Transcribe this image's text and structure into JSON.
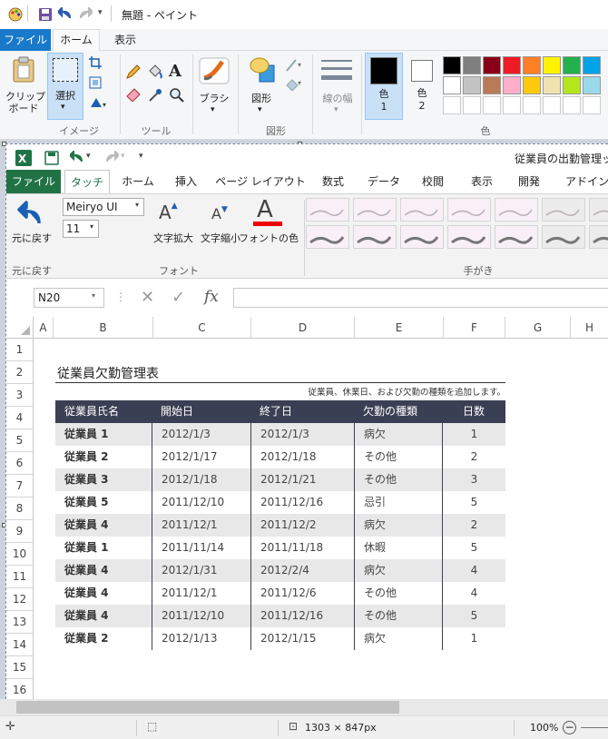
{
  "paint": {
    "window_title": "無題 - ペイント",
    "tabs": [
      "ファイル",
      "ホーム",
      "表示"
    ],
    "clipboard_label": "クリップ\nボード",
    "select_label": "選択",
    "group_image": "イメージ",
    "group_tools": "ツール",
    "brush_label": "ブラシ",
    "shapes_label": "図形",
    "group_shapes": "図形",
    "line_width_label": "線の幅",
    "color1_label": "色\n1",
    "color2_label": "色\n2",
    "group_colors": "色",
    "palette_row1": [
      "#000000",
      "#7f7f7f",
      "#880015",
      "#ed1c24",
      "#ff7f27",
      "#fff200",
      "#22b14c",
      "#00a2e8"
    ],
    "palette_row2": [
      "#ffffff",
      "#c3c3c3",
      "#b97a57",
      "#ffaec9",
      "#ffc90e",
      "#efe4b0",
      "#b5e61d",
      "#99d9ea"
    ],
    "color1": "#000000",
    "color2": "#ffffff",
    "status_dimensions": "1303 × 847px",
    "zoom": "100%"
  },
  "excel": {
    "title": "従業員の出勤管理ッ",
    "tabs": [
      "ファイル",
      "タッチ",
      "ホーム",
      "挿入",
      "ページ レイアウト",
      "数式",
      "データ",
      "校閲",
      "表示",
      "開発",
      "アドイン"
    ],
    "undo_label": "元に戻す",
    "undo_group": "元に戻す",
    "font_name": "Meiryo UI",
    "font_size": "11",
    "grow_label": "文字拡大",
    "shrink_label": "文字縮小",
    "font_color_label": "フォントの色",
    "font_group": "フォント",
    "ink_group": "手がき",
    "name_box": "N20",
    "fx": "fx",
    "columns": [
      "A",
      "B",
      "C",
      "D",
      "E",
      "F",
      "G",
      "H"
    ],
    "rows": [
      "1",
      "2",
      "3",
      "4",
      "5",
      "6",
      "7",
      "8",
      "9",
      "10",
      "11",
      "12",
      "13",
      "14",
      "15",
      "16"
    ],
    "sheet_title": "従業員欠勤管理表",
    "note": "従業員、休業日、および欠勤の種類を追加します。",
    "table": {
      "headers": [
        "従業員氏名",
        "開始日",
        "終了日",
        "欠勤の種類",
        "日数"
      ],
      "rows": [
        [
          "従業員 1",
          "2012/1/3",
          "2012/1/3",
          "病欠",
          "1"
        ],
        [
          "従業員 2",
          "2012/1/17",
          "2012/1/18",
          "その他",
          "2"
        ],
        [
          "従業員 3",
          "2012/1/18",
          "2012/1/21",
          "その他",
          "3"
        ],
        [
          "従業員 5",
          "2011/12/10",
          "2011/12/16",
          "忌引",
          "5"
        ],
        [
          "従業員 4",
          "2011/12/1",
          "2011/12/2",
          "病欠",
          "2"
        ],
        [
          "従業員 1",
          "2011/11/14",
          "2011/11/18",
          "休暇",
          "5"
        ],
        [
          "従業員 4",
          "2012/1/31",
          "2012/2/4",
          "病欠",
          "4"
        ],
        [
          "従業員 4",
          "2011/12/1",
          "2011/12/6",
          "その他",
          "4"
        ],
        [
          "従業員 4",
          "2011/12/10",
          "2011/12/16",
          "その他",
          "5"
        ],
        [
          "従業員 2",
          "2012/1/13",
          "2012/1/15",
          "病欠",
          "1"
        ]
      ]
    }
  }
}
